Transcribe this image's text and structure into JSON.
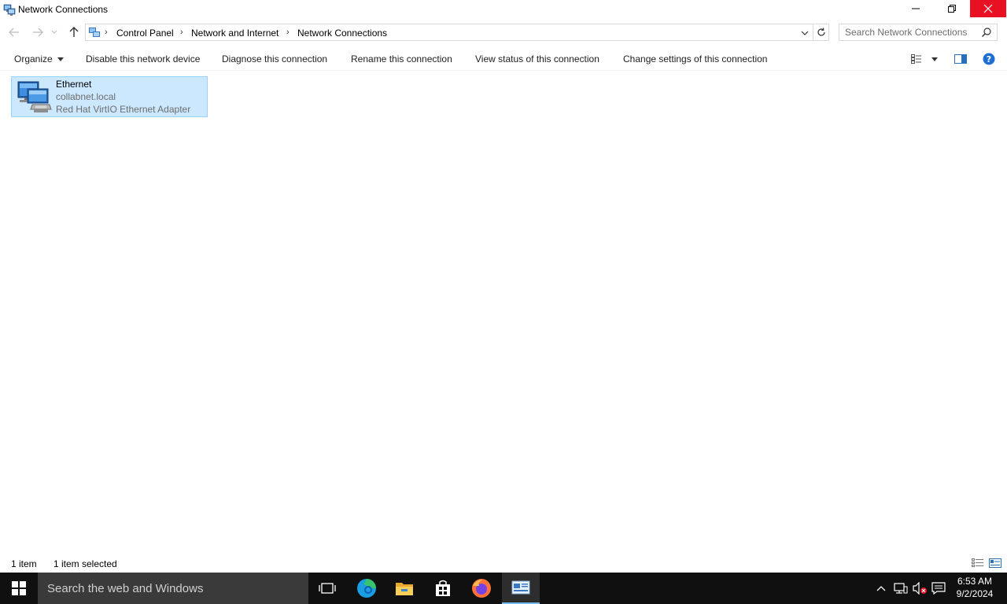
{
  "window": {
    "title": "Network Connections",
    "close_color": "#e81123"
  },
  "nav": {
    "breadcrumbs": [
      "Control Panel",
      "Network and Internet",
      "Network Connections"
    ],
    "search_placeholder": "Search Network Connections"
  },
  "toolbar": {
    "organize_label": "Organize",
    "disable_label": "Disable this network device",
    "diagnose_label": "Diagnose this connection",
    "rename_label": "Rename this connection",
    "view_status_label": "View status of this connection",
    "change_settings_label": "Change settings of this connection"
  },
  "items": [
    {
      "name": "Ethernet",
      "network": "collabnet.local",
      "adapter": "Red Hat VirtIO Ethernet Adapter",
      "selected": true,
      "icon": "network-adapter-icon"
    }
  ],
  "status": {
    "count": "1 item",
    "selected": "1 item selected"
  },
  "taskbar": {
    "search_placeholder": "Search the web and Windows",
    "pinned": [
      "task-view-icon",
      "edge-icon",
      "file-explorer-icon",
      "store-icon",
      "firefox-icon",
      "network-connections-icon"
    ],
    "time": "6:53 AM",
    "date": "9/2/2024",
    "accent": "#76b9ed"
  }
}
